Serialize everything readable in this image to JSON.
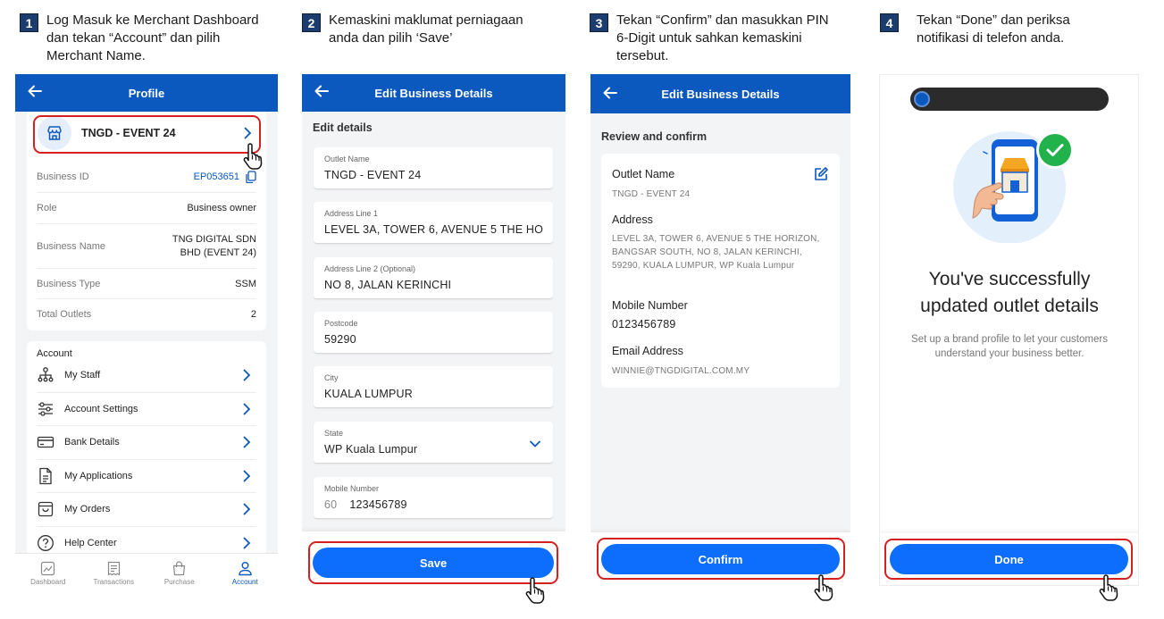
{
  "steps": [
    {
      "num": "1",
      "text": "Log Masuk ke Merchant Dashboard dan tekan “Account” dan pilih Merchant Name."
    },
    {
      "num": "2",
      "text": "Kemaskini maklumat perniagaan anda dan pilih ‘Save’"
    },
    {
      "num": "3",
      "text": "Tekan “Confirm” dan masukkan PIN 6-Digit untuk sahkan kemaskini tersebut."
    },
    {
      "num": "4",
      "text": "Tekan “Done” dan periksa notifikasi di telefon anda."
    }
  ],
  "profile": {
    "title": "Profile",
    "merchant_name": "TNGD - EVENT 24",
    "rows": [
      {
        "key": "Business ID",
        "value": "EP053651"
      },
      {
        "key": "Role",
        "value": "Business owner"
      },
      {
        "key": "Business Name",
        "value": "TNG DIGITAL SDN BHD (EVENT 24)"
      },
      {
        "key": "Business Type",
        "value": "SSM"
      },
      {
        "key": "Total Outlets",
        "value": "2"
      }
    ],
    "account_heading": "Account",
    "menu": [
      {
        "label": "My Staff",
        "icon": "staff-icon"
      },
      {
        "label": "Account Settings",
        "icon": "settings-sliders-icon"
      },
      {
        "label": "Bank Details",
        "icon": "card-icon"
      },
      {
        "label": "My Applications",
        "icon": "document-icon"
      },
      {
        "label": "My Orders",
        "icon": "bag-icon"
      },
      {
        "label": "Help Center",
        "icon": "help-icon"
      }
    ],
    "tabs": [
      {
        "label": "Dashboard",
        "icon": "chart-icon"
      },
      {
        "label": "Transactions",
        "icon": "receipt-icon"
      },
      {
        "label": "Purchase",
        "icon": "purchase-bag-icon"
      },
      {
        "label": "Account",
        "icon": "user-icon"
      }
    ]
  },
  "edit": {
    "title": "Edit Business Details",
    "section": "Edit details",
    "fields": [
      {
        "label": "Outlet Name",
        "value": "TNGD - EVENT 24"
      },
      {
        "label": "Address Line 1",
        "value": "LEVEL 3A, TOWER 6, AVENUE 5 THE HO"
      },
      {
        "label": "Address Line 2 (Optional)",
        "value": "NO 8, JALAN KERINCHI"
      },
      {
        "label": "Postcode",
        "value": "59290"
      },
      {
        "label": "City",
        "value": "KUALA LUMPUR"
      },
      {
        "label": "State",
        "value": "WP Kuala Lumpur"
      },
      {
        "label": "Mobile Number",
        "prefix": "60",
        "value": "123456789"
      }
    ],
    "save_label": "Save"
  },
  "review": {
    "title": "Edit Business Details",
    "section": "Review and confirm",
    "outlet_label": "Outlet Name",
    "outlet_value": "TNGD - EVENT 24",
    "address_label": "Address",
    "address_value": "LEVEL 3A, TOWER 6, AVENUE 5 THE HORIZON, BANGSAR SOUTH, NO 8, JALAN KERINCHI, 59290, KUALA LUMPUR, WP Kuala Lumpur",
    "mobile_label": "Mobile Number",
    "mobile_value": "0123456789",
    "email_label": "Email Address",
    "email_value": "WINNIE@TNGDIGITAL.COM.MY",
    "confirm_label": "Confirm"
  },
  "success": {
    "heading": "You've successfully updated outlet details",
    "subtext": "Set up a brand profile to let your customers understand your business better.",
    "done_label": "Done"
  },
  "colors": {
    "primary": "#0b58be",
    "button": "#0d6efd",
    "highlight": "#d42020",
    "success": "#22b24c"
  }
}
